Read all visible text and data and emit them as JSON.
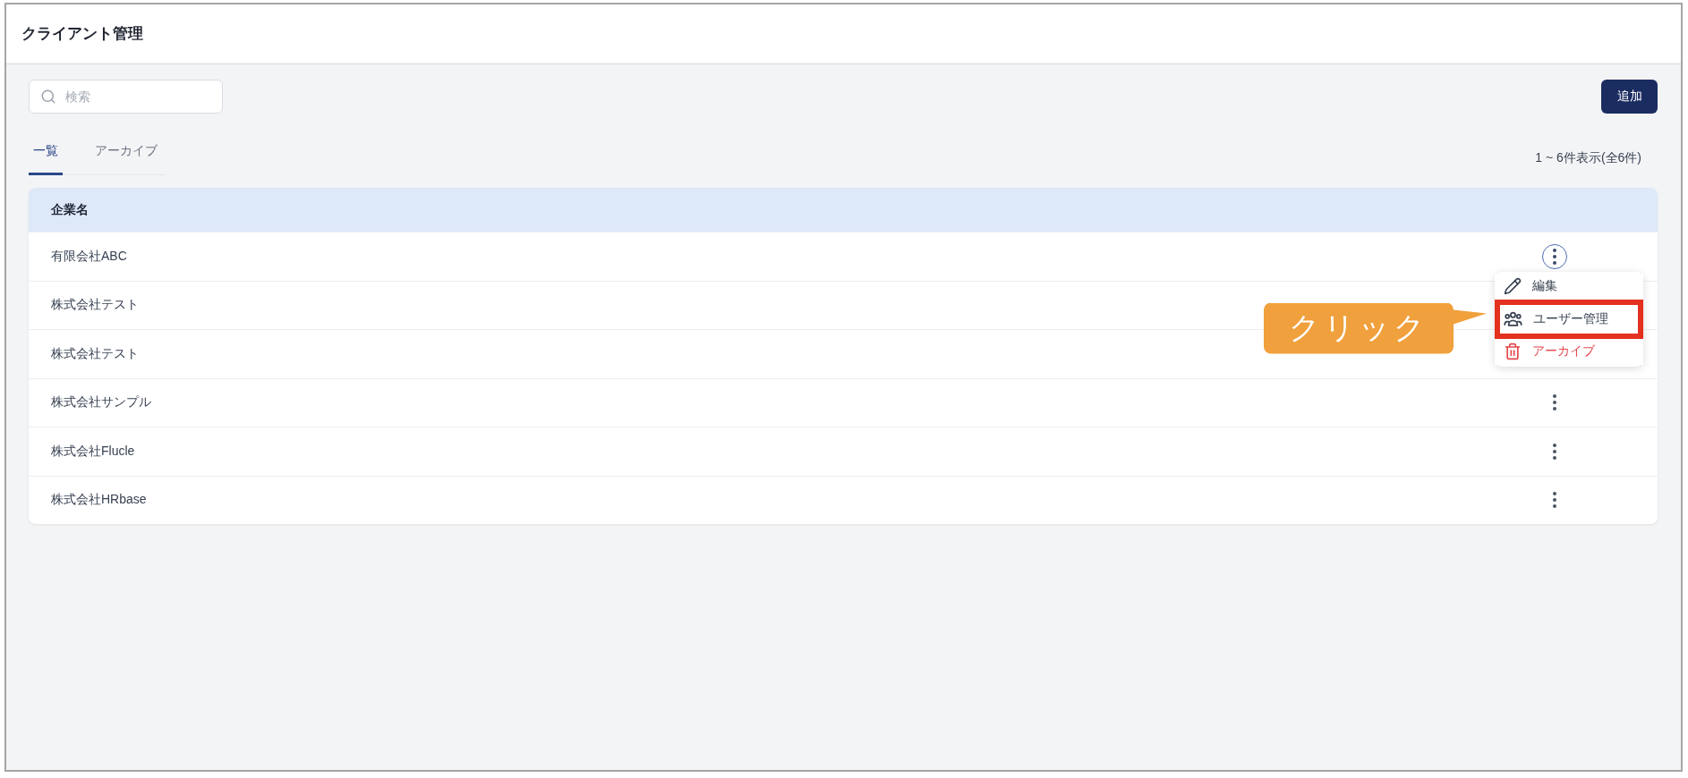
{
  "header": {
    "title": "クライアント管理"
  },
  "toolbar": {
    "search": {
      "placeholder": "検索"
    },
    "add_button": "追加"
  },
  "tabs": [
    {
      "label": "一覧",
      "selected": true
    },
    {
      "label": "アーカイブ",
      "selected": false
    }
  ],
  "count": "1 ~ 6件表示(全6件)",
  "table": {
    "columns": [
      "企業名"
    ],
    "rows": [
      {
        "name": "有限会社ABC",
        "menu_open": true
      },
      {
        "name": "株式会社テスト",
        "menu_open": false
      },
      {
        "name": "株式会社テスト",
        "menu_open": false
      },
      {
        "name": "株式会社サンプル",
        "menu_open": false
      },
      {
        "name": "株式会社Flucle",
        "menu_open": false
      },
      {
        "name": "株式会社HRbase",
        "menu_open": false
      }
    ]
  },
  "row_menu": {
    "items": [
      {
        "label": "編集",
        "kind": "edit",
        "highlighted": false
      },
      {
        "label": "ユーザー管理",
        "kind": "manage",
        "highlighted": true,
        "callout": "クリック"
      },
      {
        "label": "アーカイブ",
        "kind": "archive",
        "highlighted": false
      }
    ]
  }
}
